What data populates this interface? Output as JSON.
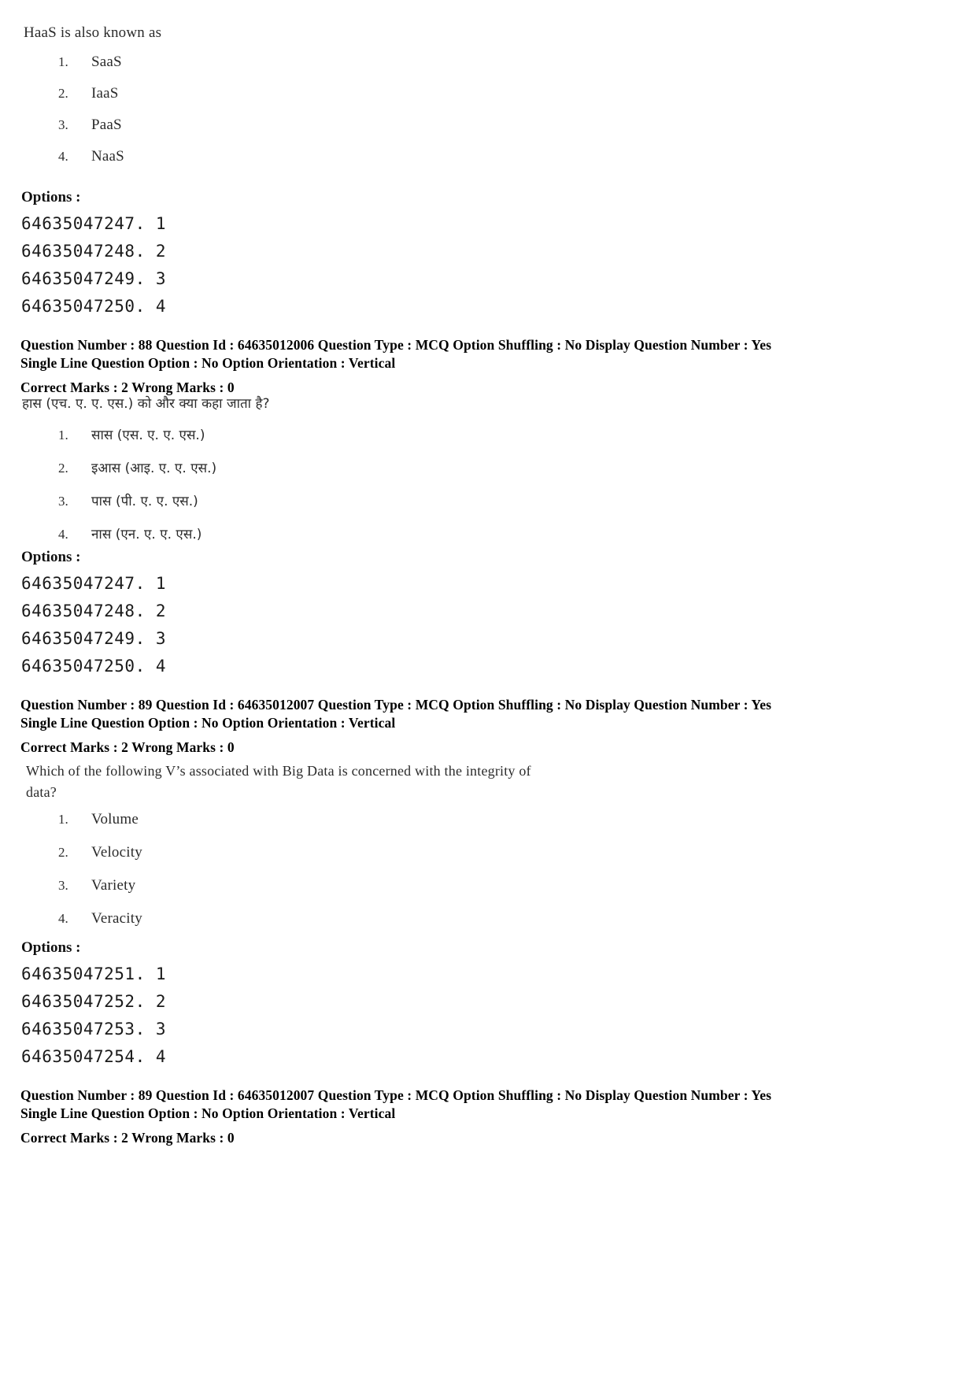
{
  "document": {
    "type": "exam-question-paper-scan"
  },
  "blocks": {
    "q88_english": {
      "question_text": "HaaS is also known as",
      "options": [
        {
          "num": "1.",
          "label": "SaaS"
        },
        {
          "num": "2.",
          "label": "IaaS"
        },
        {
          "num": "3.",
          "label": "PaaS"
        },
        {
          "num": "4.",
          "label": "NaaS"
        }
      ],
      "options_heading": "Options :",
      "option_ids": [
        "64635047247. 1",
        "64635047248. 2",
        "64635047249. 3",
        "64635047250. 4"
      ]
    },
    "meta_q88": {
      "line1": "Question Number : 88  Question Id : 64635012006  Question Type : MCQ  Option Shuffling : No  Display Question Number : Yes",
      "line2": "Single Line Question Option : No  Option Orientation : Vertical",
      "line3": "Correct Marks : 2  Wrong Marks : 0"
    },
    "q88_hindi": {
      "question_text": "हास (एच. ए. ए. एस.) को और क्या कहा जाता है?",
      "options": [
        {
          "num": "1.",
          "label": "सास (एस. ए. ए. एस.)"
        },
        {
          "num": "2.",
          "label": "इआस (आइ. ए. ए. एस.)"
        },
        {
          "num": "3.",
          "label": "पास (पी. ए. ए. एस.)"
        },
        {
          "num": "4.",
          "label": "नास (एन. ए. ए. एस.)"
        }
      ],
      "options_heading": "Options :",
      "option_ids": [
        "64635047247. 1",
        "64635047248. 2",
        "64635047249. 3",
        "64635047250. 4"
      ]
    },
    "meta_q89_first": {
      "line1": "Question Number : 89  Question Id : 64635012007  Question Type : MCQ  Option Shuffling : No  Display Question Number : Yes",
      "line2": "Single Line Question Option : No  Option Orientation : Vertical",
      "line3": "Correct Marks : 2  Wrong Marks : 0"
    },
    "q89_english": {
      "question_line1": "Which of the following V’s associated with Big Data is concerned with the integrity of",
      "question_line2": "data?",
      "options": [
        {
          "num": "1.",
          "label": "Volume"
        },
        {
          "num": "2.",
          "label": "Velocity"
        },
        {
          "num": "3.",
          "label": "Variety"
        },
        {
          "num": "4.",
          "label": "Veracity"
        }
      ],
      "options_heading": "Options :",
      "option_ids": [
        "64635047251. 1",
        "64635047252. 2",
        "64635047253. 3",
        "64635047254. 4"
      ]
    },
    "meta_q89_second": {
      "line1": "Question Number : 89  Question Id : 64635012007  Question Type : MCQ  Option Shuffling : No  Display Question Number : Yes",
      "line2": "Single Line Question Option : No  Option Orientation : Vertical",
      "line3": "Correct Marks : 2  Wrong Marks : 0"
    }
  }
}
